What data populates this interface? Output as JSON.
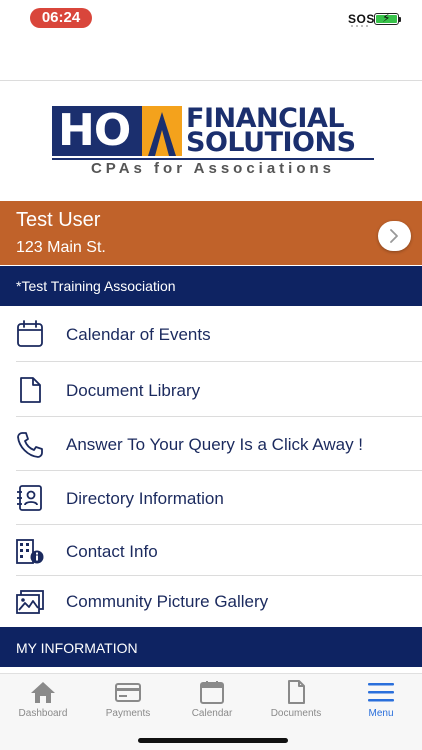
{
  "status_bar": {
    "time": "06:24",
    "carrier_text": "SOS"
  },
  "logo": {
    "mark": "HO",
    "line1": "FINANCIAL",
    "line2": "SOLUTIONS",
    "tagline": "CPAs for Associations",
    "colors": {
      "navy": "#1b2f6e",
      "orange": "#f4a21c"
    }
  },
  "user": {
    "name": "Test User",
    "address": "123 Main St.",
    "banner_color": "#c0622a"
  },
  "association": {
    "name": "*Test Training Association"
  },
  "menu": {
    "items": [
      {
        "label": "Calendar of Events",
        "icon": "calendar-icon"
      },
      {
        "label": "Document Library",
        "icon": "document-icon"
      },
      {
        "label": "Answer To Your Query Is a Click Away !",
        "icon": "phone-icon"
      },
      {
        "label": "Directory Information",
        "icon": "contact-card-icon"
      },
      {
        "label": "Contact Info",
        "icon": "building-info-icon"
      },
      {
        "label": "Community Picture Gallery",
        "icon": "gallery-icon"
      }
    ]
  },
  "section": {
    "my_information": "MY INFORMATION"
  },
  "tabbar": {
    "active_color": "#2a6fdb",
    "tabs": [
      {
        "label": "Dashboard",
        "icon": "home-icon"
      },
      {
        "label": "Payments",
        "icon": "credit-card-icon"
      },
      {
        "label": "Calendar",
        "icon": "calendar-icon"
      },
      {
        "label": "Documents",
        "icon": "document-icon"
      },
      {
        "label": "Menu",
        "icon": "hamburger-menu-icon",
        "active": true
      }
    ]
  }
}
